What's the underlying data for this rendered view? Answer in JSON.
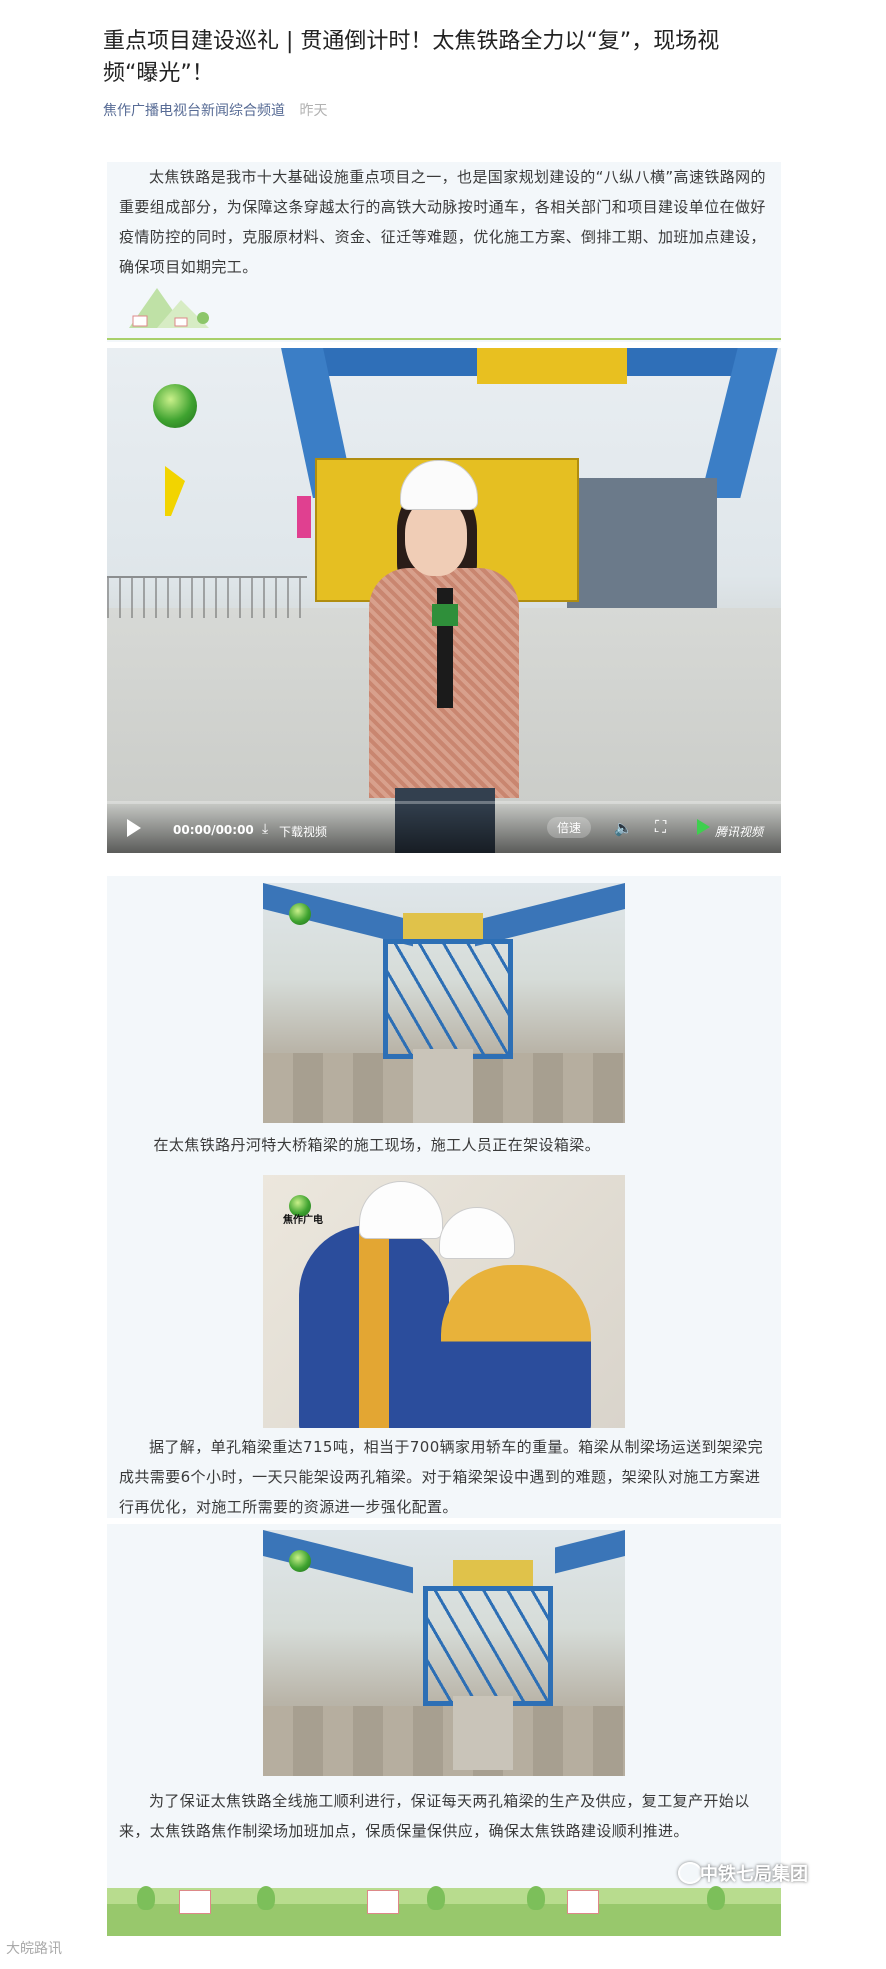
{
  "article": {
    "title": "重点项目建设巡礼 | 贯通倒计时！太焦铁路全力以“复”，现场视频“曝光”！",
    "account": "焦作广播电视台新闻综合频道",
    "time": "昨天"
  },
  "paragraphs": {
    "intro": "太焦铁路是我市十大基础设施重点项目之一，也是国家规划建设的“八纵八横”高速铁路网的重要组成部分，为保障这条穿越太行的高铁大动脉按时通车，各相关部门和项目建设单位在做好疫情防控的同时，克服原材料、资金、征迁等难题，优化施工方案、倒排工期、加班加点建设，确保项目如期完工。",
    "caption1": "在太焦铁路丹河特大桥箱梁的施工现场，施工人员正在架设箱梁。",
    "body2": "据了解，单孔箱梁重达715吨，相当于700辆家用轿车的重量。箱梁从制梁场运送到架梁完成共需要6个小时，一天只能架设两孔箱梁。对于箱梁架设中遇到的难题，架梁队对施工方案进行再优化，对施工所需要的资源进一步强化配置。",
    "body3": "为了保证太焦铁路全线施工顺利进行，保证每天两孔箱梁的生产及供应，复工复产开始以来，太焦铁路焦作制梁场加班加点，保质保量保供应，确保太焦铁路建设顺利推进。"
  },
  "video": {
    "time": "00:00/00:00",
    "download_label": "下载视频",
    "speed_label": "倍速",
    "brand_label": "腾讯视频",
    "progress": 0,
    "icons": [
      "play-icon",
      "download-icon",
      "volume-icon",
      "fullscreen-icon",
      "tencent-video-icon"
    ]
  },
  "photo_overlay": {
    "channel_label": "焦作广电"
  },
  "footer": {
    "watermark": "大皖路讯",
    "brand": "中铁七局集团"
  },
  "colors": {
    "account_link": "#576b95",
    "panel_bg": "#f3f7fa",
    "accent_green": "#a8d06a"
  }
}
